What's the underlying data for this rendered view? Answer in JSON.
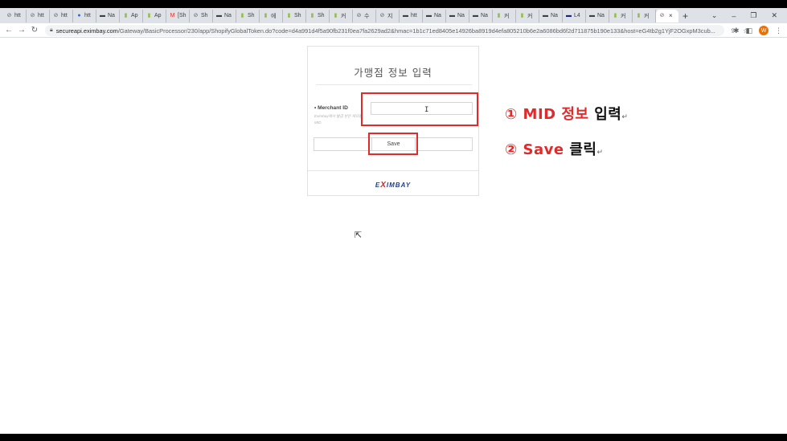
{
  "tabs": [
    {
      "icon": "globe-icon",
      "label": "htt",
      "color": "#5f6368"
    },
    {
      "icon": "globe-icon",
      "label": "htt",
      "color": "#5f6368"
    },
    {
      "icon": "globe-icon",
      "label": "htt",
      "color": "#5f6368"
    },
    {
      "icon": "app-icon",
      "label": "htt",
      "color": "#1a73e8"
    },
    {
      "icon": "bookmark-icon",
      "label": "Na",
      "color": "#3c4043"
    },
    {
      "icon": "shopify-icon",
      "label": "Ap",
      "color": "#95bf47"
    },
    {
      "icon": "shopify-icon",
      "label": "Ap",
      "color": "#95bf47"
    },
    {
      "icon": "gmail-icon",
      "label": "[Sh",
      "color": "#d93025"
    },
    {
      "icon": "globe-icon",
      "label": "Sh",
      "color": "#5f6368"
    },
    {
      "icon": "bookmark-icon",
      "label": "Na",
      "color": "#3c4043"
    },
    {
      "icon": "shopify-icon",
      "label": "Sh",
      "color": "#95bf47"
    },
    {
      "icon": "shopify-icon",
      "label": "에",
      "color": "#95bf47"
    },
    {
      "icon": "shopify-icon",
      "label": "Sh",
      "color": "#95bf47"
    },
    {
      "icon": "shopify-icon",
      "label": "Sh",
      "color": "#95bf47"
    },
    {
      "icon": "shopify-icon",
      "label": "커",
      "color": "#95bf47"
    },
    {
      "icon": "globe-icon",
      "label": "수",
      "color": "#5f6368"
    },
    {
      "icon": "globe-icon",
      "label": "지",
      "color": "#5f6368"
    },
    {
      "icon": "bookmark-icon",
      "label": "htt",
      "color": "#3c4043"
    },
    {
      "icon": "bookmark-icon",
      "label": "Na",
      "color": "#3c4043"
    },
    {
      "icon": "bookmark-icon",
      "label": "Na",
      "color": "#3c4043"
    },
    {
      "icon": "bookmark-icon",
      "label": "Na",
      "color": "#3c4043"
    },
    {
      "icon": "shopify-icon",
      "label": "커",
      "color": "#95bf47"
    },
    {
      "icon": "shopify-icon",
      "label": "커",
      "color": "#95bf47"
    },
    {
      "icon": "bookmark-icon",
      "label": "Na",
      "color": "#3c4043"
    },
    {
      "icon": "lg-icon",
      "label": "L4",
      "color": "#1a237e"
    },
    {
      "icon": "bookmark-icon",
      "label": "Na",
      "color": "#3c4043"
    },
    {
      "icon": "shopify-icon",
      "label": "커",
      "color": "#95bf47"
    },
    {
      "icon": "shopify-icon",
      "label": "커",
      "color": "#95bf47"
    }
  ],
  "active_tab": {
    "icon": "globe-icon",
    "close": "×"
  },
  "new_tab": "+",
  "window_controls": {
    "dropdown": "⌄",
    "minimize": "–",
    "restore": "❐",
    "close": "✕"
  },
  "address": {
    "host": "secureapi.eximbay.com",
    "path": "/Gateway/BasicProcessor/230/app/ShopifyGlobalToken.do?code=d4a991d4f5a90fb231f0ea7fa2629ad2&hmac=1b1c71ed8405e14926ba8919d4efa805210b6e2a6086bd6f2d711875b190e133&host=eG4tb2g1YjF2OGxpM3cub..."
  },
  "profile_initial": "W",
  "form": {
    "title": "가맹점 정보 입력",
    "merchant_id_label": "• Merchant ID",
    "merchant_id_hint": "Eximbay에서 발급 받은 재외용 MID",
    "merchant_id_value": "",
    "save_label": "Save",
    "logo_text_pre": "E",
    "logo_text_x": "X",
    "logo_text_post": "IMBAY"
  },
  "annotations": {
    "step1_num": "①",
    "step1_red": "MID 정보",
    "step1_black": "입력",
    "step2_num": "②",
    "step2_red": "Save",
    "step2_black": "클릭",
    "return_mark": "↵"
  },
  "colors": {
    "highlight": "#e12a2a",
    "logo_blue": "#1f3e8a",
    "logo_red": "#d2232a"
  }
}
